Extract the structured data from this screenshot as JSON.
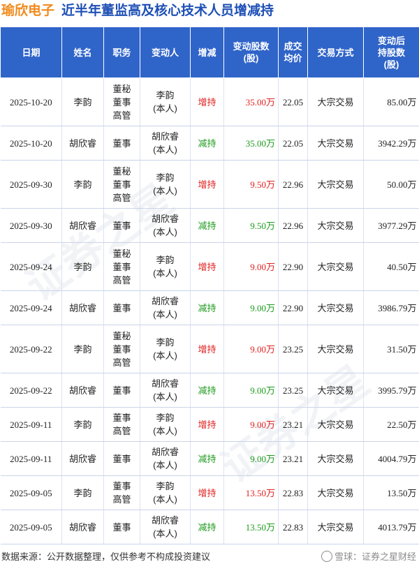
{
  "header": {
    "company": "瑜欣电子",
    "headline": "近半年董监高及核心技术人员增减持"
  },
  "table": {
    "columns": [
      "日期",
      "姓名",
      "职务",
      "变动人",
      "增减",
      "变动股数\n(股)",
      "成交\n均价",
      "交易方式",
      "变动后\n持股数\n(股)"
    ],
    "rows": [
      {
        "date": "2025-10-20",
        "name": "李韵",
        "role": "董秘\n董事\n高管",
        "actor": "李韵\n(本人)",
        "direction": "增持",
        "shares": "35.00万",
        "price": "22.05",
        "method": "大宗交易",
        "after": "85.00万"
      },
      {
        "date": "2025-10-20",
        "name": "胡欣睿",
        "role": "董事",
        "actor": "胡欣睿\n(本人)",
        "direction": "减持",
        "shares": "35.00万",
        "price": "22.05",
        "method": "大宗交易",
        "after": "3942.29万"
      },
      {
        "date": "2025-09-30",
        "name": "李韵",
        "role": "董秘\n董事\n高管",
        "actor": "李韵\n(本人)",
        "direction": "增持",
        "shares": "9.50万",
        "price": "22.96",
        "method": "大宗交易",
        "after": "50.00万"
      },
      {
        "date": "2025-09-30",
        "name": "胡欣睿",
        "role": "董事",
        "actor": "胡欣睿\n(本人)",
        "direction": "减持",
        "shares": "9.50万",
        "price": "22.96",
        "method": "大宗交易",
        "after": "3977.29万"
      },
      {
        "date": "2025-09-24",
        "name": "李韵",
        "role": "董秘\n董事\n高管",
        "actor": "李韵\n(本人)",
        "direction": "增持",
        "shares": "9.00万",
        "price": "22.90",
        "method": "大宗交易",
        "after": "40.50万"
      },
      {
        "date": "2025-09-24",
        "name": "胡欣睿",
        "role": "董事",
        "actor": "胡欣睿\n(本人)",
        "direction": "减持",
        "shares": "9.00万",
        "price": "22.90",
        "method": "大宗交易",
        "after": "3986.79万"
      },
      {
        "date": "2025-09-22",
        "name": "李韵",
        "role": "董秘\n董事\n高管",
        "actor": "李韵\n(本人)",
        "direction": "增持",
        "shares": "9.00万",
        "price": "23.25",
        "method": "大宗交易",
        "after": "31.50万"
      },
      {
        "date": "2025-09-22",
        "name": "胡欣睿",
        "role": "董事",
        "actor": "胡欣睿\n(本人)",
        "direction": "减持",
        "shares": "9.00万",
        "price": "23.25",
        "method": "大宗交易",
        "after": "3995.79万"
      },
      {
        "date": "2025-09-11",
        "name": "李韵",
        "role": "董事\n高管",
        "actor": "李韵\n(本人)",
        "direction": "增持",
        "shares": "9.00万",
        "price": "23.21",
        "method": "大宗交易",
        "after": "22.50万"
      },
      {
        "date": "2025-09-11",
        "name": "胡欣睿",
        "role": "董事",
        "actor": "胡欣睿\n(本人)",
        "direction": "减持",
        "shares": "9.00万",
        "price": "23.21",
        "method": "大宗交易",
        "after": "4004.79万"
      },
      {
        "date": "2025-09-05",
        "name": "李韵",
        "role": "董事\n高管",
        "actor": "李韵\n(本人)",
        "direction": "增持",
        "shares": "13.50万",
        "price": "22.83",
        "method": "大宗交易",
        "after": "13.50万"
      },
      {
        "date": "2025-09-05",
        "name": "胡欣睿",
        "role": "董事",
        "actor": "胡欣睿\n(本人)",
        "direction": "减持",
        "shares": "13.50万",
        "price": "22.83",
        "method": "大宗交易",
        "after": "4013.79万"
      }
    ]
  },
  "footer": {
    "note": "数据来源：公开数据整理，仅供参考不构成投资建议",
    "brand": "雪球：证券之星财经"
  },
  "watermark": "证券之星",
  "colors": {
    "company": "#f08a1c",
    "headline": "#1e4fb5",
    "header_bg": "#2f64c9",
    "increase": "#e02020",
    "decrease": "#1c9a1c"
  }
}
